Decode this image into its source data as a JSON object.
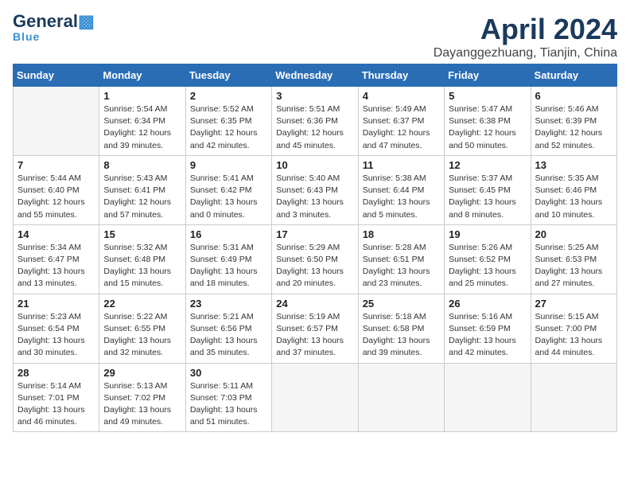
{
  "header": {
    "logo_general": "General",
    "logo_blue": "Blue",
    "month_title": "April 2024",
    "location": "Dayanggezhuang, Tianjin, China"
  },
  "weekdays": [
    "Sunday",
    "Monday",
    "Tuesday",
    "Wednesday",
    "Thursday",
    "Friday",
    "Saturday"
  ],
  "weeks": [
    [
      {
        "day": "",
        "empty": true
      },
      {
        "day": "1",
        "sunrise": "5:54 AM",
        "sunset": "6:34 PM",
        "daylight": "12 hours and 39 minutes."
      },
      {
        "day": "2",
        "sunrise": "5:52 AM",
        "sunset": "6:35 PM",
        "daylight": "12 hours and 42 minutes."
      },
      {
        "day": "3",
        "sunrise": "5:51 AM",
        "sunset": "6:36 PM",
        "daylight": "12 hours and 45 minutes."
      },
      {
        "day": "4",
        "sunrise": "5:49 AM",
        "sunset": "6:37 PM",
        "daylight": "12 hours and 47 minutes."
      },
      {
        "day": "5",
        "sunrise": "5:47 AM",
        "sunset": "6:38 PM",
        "daylight": "12 hours and 50 minutes."
      },
      {
        "day": "6",
        "sunrise": "5:46 AM",
        "sunset": "6:39 PM",
        "daylight": "12 hours and 52 minutes."
      }
    ],
    [
      {
        "day": "7",
        "sunrise": "5:44 AM",
        "sunset": "6:40 PM",
        "daylight": "12 hours and 55 minutes."
      },
      {
        "day": "8",
        "sunrise": "5:43 AM",
        "sunset": "6:41 PM",
        "daylight": "12 hours and 57 minutes."
      },
      {
        "day": "9",
        "sunrise": "5:41 AM",
        "sunset": "6:42 PM",
        "daylight": "13 hours and 0 minutes."
      },
      {
        "day": "10",
        "sunrise": "5:40 AM",
        "sunset": "6:43 PM",
        "daylight": "13 hours and 3 minutes."
      },
      {
        "day": "11",
        "sunrise": "5:38 AM",
        "sunset": "6:44 PM",
        "daylight": "13 hours and 5 minutes."
      },
      {
        "day": "12",
        "sunrise": "5:37 AM",
        "sunset": "6:45 PM",
        "daylight": "13 hours and 8 minutes."
      },
      {
        "day": "13",
        "sunrise": "5:35 AM",
        "sunset": "6:46 PM",
        "daylight": "13 hours and 10 minutes."
      }
    ],
    [
      {
        "day": "14",
        "sunrise": "5:34 AM",
        "sunset": "6:47 PM",
        "daylight": "13 hours and 13 minutes."
      },
      {
        "day": "15",
        "sunrise": "5:32 AM",
        "sunset": "6:48 PM",
        "daylight": "13 hours and 15 minutes."
      },
      {
        "day": "16",
        "sunrise": "5:31 AM",
        "sunset": "6:49 PM",
        "daylight": "13 hours and 18 minutes."
      },
      {
        "day": "17",
        "sunrise": "5:29 AM",
        "sunset": "6:50 PM",
        "daylight": "13 hours and 20 minutes."
      },
      {
        "day": "18",
        "sunrise": "5:28 AM",
        "sunset": "6:51 PM",
        "daylight": "13 hours and 23 minutes."
      },
      {
        "day": "19",
        "sunrise": "5:26 AM",
        "sunset": "6:52 PM",
        "daylight": "13 hours and 25 minutes."
      },
      {
        "day": "20",
        "sunrise": "5:25 AM",
        "sunset": "6:53 PM",
        "daylight": "13 hours and 27 minutes."
      }
    ],
    [
      {
        "day": "21",
        "sunrise": "5:23 AM",
        "sunset": "6:54 PM",
        "daylight": "13 hours and 30 minutes."
      },
      {
        "day": "22",
        "sunrise": "5:22 AM",
        "sunset": "6:55 PM",
        "daylight": "13 hours and 32 minutes."
      },
      {
        "day": "23",
        "sunrise": "5:21 AM",
        "sunset": "6:56 PM",
        "daylight": "13 hours and 35 minutes."
      },
      {
        "day": "24",
        "sunrise": "5:19 AM",
        "sunset": "6:57 PM",
        "daylight": "13 hours and 37 minutes."
      },
      {
        "day": "25",
        "sunrise": "5:18 AM",
        "sunset": "6:58 PM",
        "daylight": "13 hours and 39 minutes."
      },
      {
        "day": "26",
        "sunrise": "5:16 AM",
        "sunset": "6:59 PM",
        "daylight": "13 hours and 42 minutes."
      },
      {
        "day": "27",
        "sunrise": "5:15 AM",
        "sunset": "7:00 PM",
        "daylight": "13 hours and 44 minutes."
      }
    ],
    [
      {
        "day": "28",
        "sunrise": "5:14 AM",
        "sunset": "7:01 PM",
        "daylight": "13 hours and 46 minutes."
      },
      {
        "day": "29",
        "sunrise": "5:13 AM",
        "sunset": "7:02 PM",
        "daylight": "13 hours and 49 minutes."
      },
      {
        "day": "30",
        "sunrise": "5:11 AM",
        "sunset": "7:03 PM",
        "daylight": "13 hours and 51 minutes."
      },
      {
        "day": "",
        "empty": true
      },
      {
        "day": "",
        "empty": true
      },
      {
        "day": "",
        "empty": true
      },
      {
        "day": "",
        "empty": true
      }
    ]
  ],
  "labels": {
    "sunrise_prefix": "Sunrise: ",
    "sunset_prefix": "Sunset: ",
    "daylight_prefix": "Daylight: "
  }
}
